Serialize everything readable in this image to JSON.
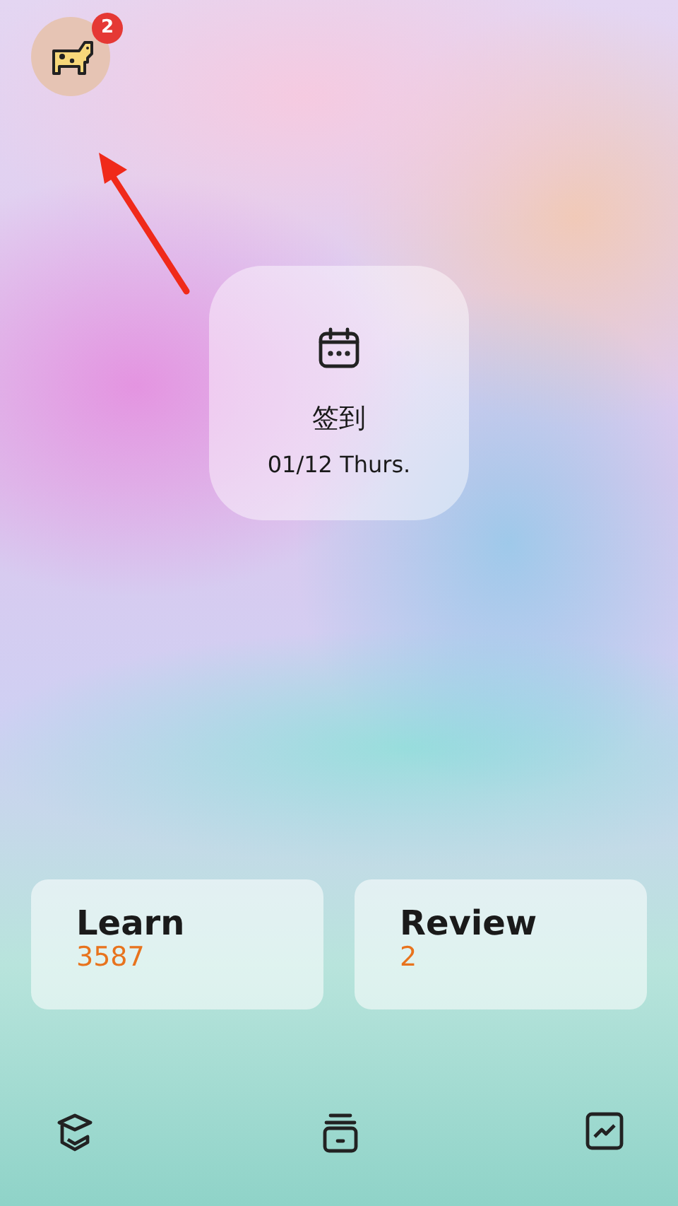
{
  "profile": {
    "badge": "2"
  },
  "check_in": {
    "title": "签到",
    "date": "01/12 Thurs."
  },
  "stats": [
    {
      "label": "Learn",
      "value": "3587"
    },
    {
      "label": "Review",
      "value": "2"
    }
  ]
}
